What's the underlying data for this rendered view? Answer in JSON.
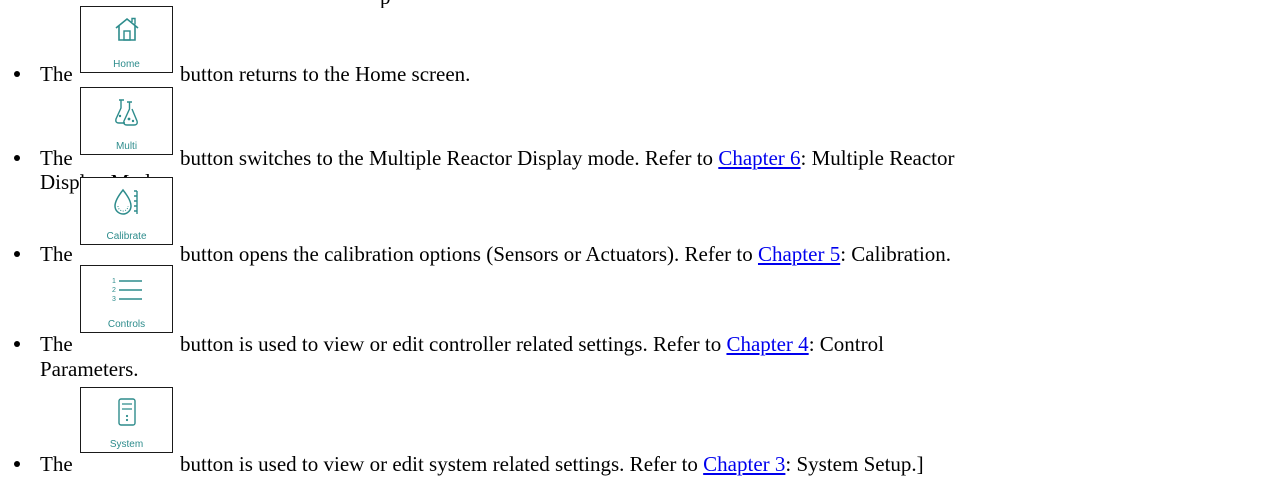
{
  "header_fragment": "p",
  "accent_color": "#2d8c8c",
  "items": [
    {
      "prefix": "The",
      "button_label": "Home",
      "icon": "home-icon",
      "before_link": "button returns to the Home screen.",
      "link": "",
      "after_link": "",
      "line2": ""
    },
    {
      "prefix": "The",
      "button_label": "Multi",
      "icon": "flasks-icon",
      "before_link": "button switches to the Multiple Reactor Display mode. Refer to ",
      "link": "Chapter 6",
      "after_link": ": Multiple Reactor",
      "line2": "Display Mode."
    },
    {
      "prefix": "The",
      "button_label": "Calibrate",
      "icon": "drop-ruler-icon",
      "before_link": "button opens the calibration options (Sensors or Actuators). Refer to ",
      "link": "Chapter 5",
      "after_link": ": Calibration.",
      "line2": ""
    },
    {
      "prefix": "The",
      "button_label": "Controls",
      "icon": "numbered-list-icon",
      "before_link": "button is used to view or edit controller related settings. Refer to ",
      "link": "Chapter 4",
      "after_link": ": Control",
      "line2": "Parameters."
    },
    {
      "prefix": "The",
      "button_label": "System",
      "icon": "computer-tower-icon",
      "before_link": "button is used to view or edit system related settings. Refer to ",
      "link": "Chapter 3",
      "after_link": ": System Setup.]",
      "line2": ""
    }
  ]
}
